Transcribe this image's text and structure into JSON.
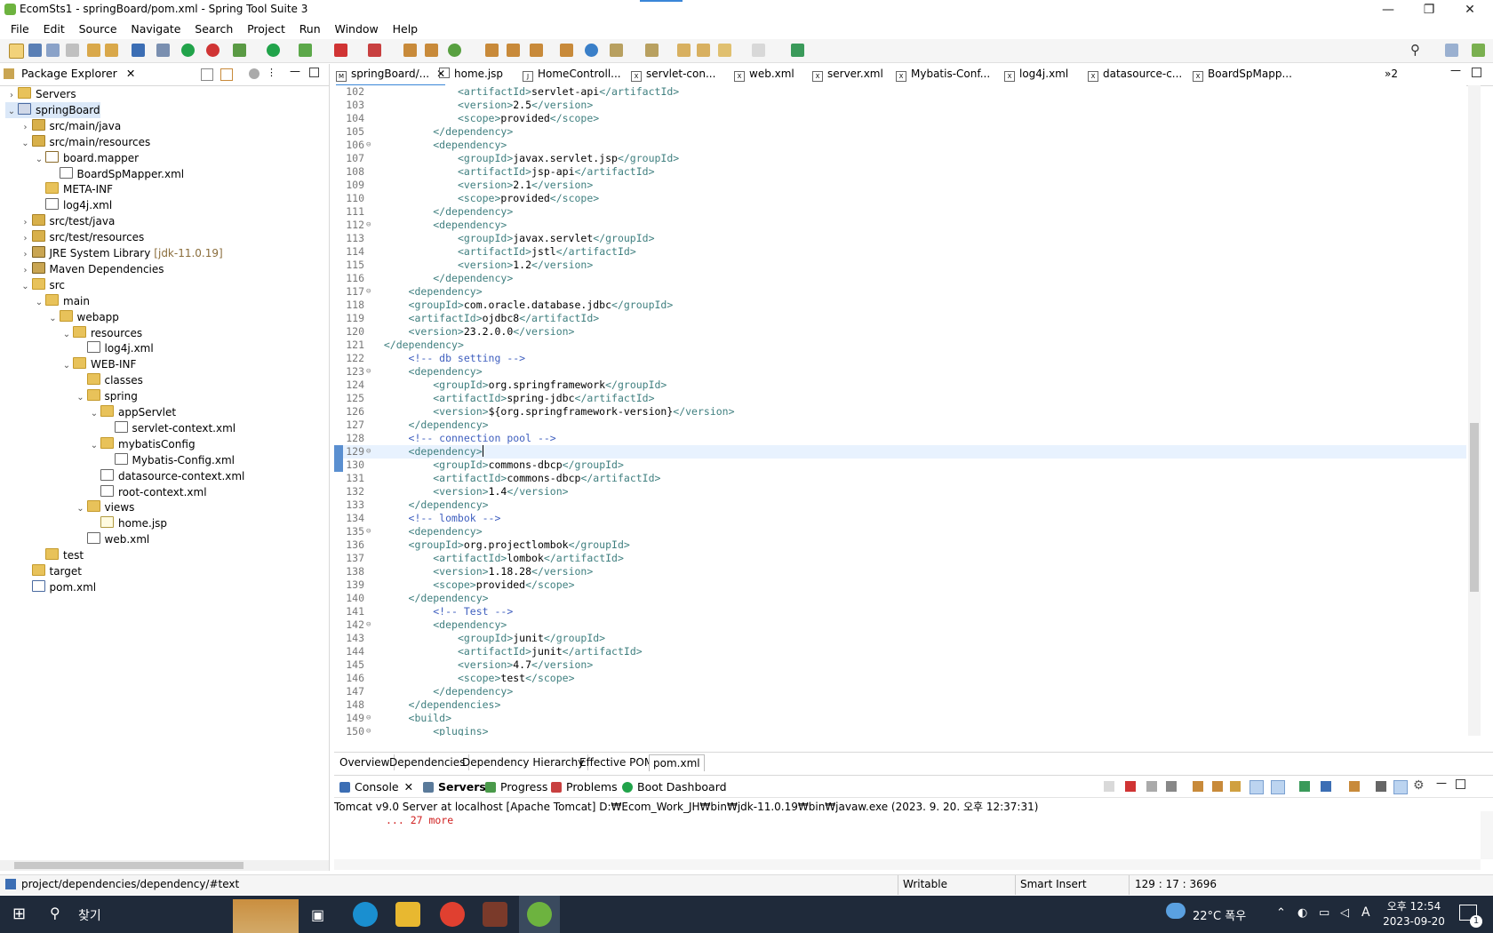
{
  "window": {
    "title": "EcomSts1 - springBoard/pom.xml - Spring Tool Suite 3"
  },
  "menu": [
    "File",
    "Edit",
    "Source",
    "Navigate",
    "Search",
    "Project",
    "Run",
    "Window",
    "Help"
  ],
  "package_explorer": {
    "title": "Package Explorer",
    "tree": [
      {
        "label": "Servers",
        "depth": 0,
        "arrow": "›",
        "icon": "servers"
      },
      {
        "label": "springBoard",
        "depth": 0,
        "arrow": "⌄",
        "icon": "proj",
        "selected": true
      },
      {
        "label": "src/main/java",
        "depth": 1,
        "arrow": "›",
        "icon": "pkgroot"
      },
      {
        "label": "src/main/resources",
        "depth": 1,
        "arrow": "⌄",
        "icon": "pkgroot"
      },
      {
        "label": "board.mapper",
        "depth": 2,
        "arrow": "⌄",
        "icon": "pkg"
      },
      {
        "label": "BoardSpMapper.xml",
        "depth": 3,
        "arrow": "",
        "icon": "xml"
      },
      {
        "label": "META-INF",
        "depth": 2,
        "arrow": "",
        "icon": "folder"
      },
      {
        "label": "log4j.xml",
        "depth": 2,
        "arrow": "",
        "icon": "xml"
      },
      {
        "label": "src/test/java",
        "depth": 1,
        "arrow": "›",
        "icon": "pkgroot"
      },
      {
        "label": "src/test/resources",
        "depth": 1,
        "arrow": "›",
        "icon": "pkgroot"
      },
      {
        "label": "JRE System Library",
        "extra": "[jdk-11.0.19]",
        "depth": 1,
        "arrow": "›",
        "icon": "lib"
      },
      {
        "label": "Maven Dependencies",
        "depth": 1,
        "arrow": "›",
        "icon": "lib"
      },
      {
        "label": "src",
        "depth": 1,
        "arrow": "⌄",
        "icon": "folder"
      },
      {
        "label": "main",
        "depth": 2,
        "arrow": "⌄",
        "icon": "folder"
      },
      {
        "label": "webapp",
        "depth": 3,
        "arrow": "⌄",
        "icon": "folder"
      },
      {
        "label": "resources",
        "depth": 4,
        "arrow": "⌄",
        "icon": "folder"
      },
      {
        "label": "log4j.xml",
        "depth": 5,
        "arrow": "",
        "icon": "xml"
      },
      {
        "label": "WEB-INF",
        "depth": 4,
        "arrow": "⌄",
        "icon": "folder"
      },
      {
        "label": "classes",
        "depth": 5,
        "arrow": "",
        "icon": "folder"
      },
      {
        "label": "spring",
        "depth": 5,
        "arrow": "⌄",
        "icon": "folder"
      },
      {
        "label": "appServlet",
        "depth": 6,
        "arrow": "⌄",
        "icon": "folder"
      },
      {
        "label": "servlet-context.xml",
        "depth": 7,
        "arrow": "",
        "icon": "xml"
      },
      {
        "label": "mybatisConfig",
        "depth": 6,
        "arrow": "⌄",
        "icon": "folder"
      },
      {
        "label": "Mybatis-Config.xml",
        "depth": 7,
        "arrow": "",
        "icon": "xml"
      },
      {
        "label": "datasource-context.xml",
        "depth": 6,
        "arrow": "",
        "icon": "xml"
      },
      {
        "label": "root-context.xml",
        "depth": 6,
        "arrow": "",
        "icon": "xml"
      },
      {
        "label": "views",
        "depth": 5,
        "arrow": "⌄",
        "icon": "folder"
      },
      {
        "label": "home.jsp",
        "depth": 6,
        "arrow": "",
        "icon": "jsp"
      },
      {
        "label": "web.xml",
        "depth": 5,
        "arrow": "",
        "icon": "xml"
      },
      {
        "label": "test",
        "depth": 2,
        "arrow": "",
        "icon": "folder"
      },
      {
        "label": "target",
        "depth": 1,
        "arrow": "",
        "icon": "folder"
      },
      {
        "label": "pom.xml",
        "depth": 1,
        "arrow": "",
        "icon": "pom"
      }
    ]
  },
  "editor_tabs": [
    "springBoard/...",
    "home.jsp",
    "HomeControll...",
    "servlet-con...",
    "web.xml",
    "server.xml",
    "Mybatis-Conf...",
    "log4j.xml",
    "datasource-c...",
    "BoardSpMapp..."
  ],
  "editor_tabs_overflow": "»2",
  "code": [
    {
      "n": "102",
      "indent": 3,
      "parts": [
        [
          "tag",
          "<artifactId>"
        ],
        [
          "txt",
          "servlet-api"
        ],
        [
          "tag",
          "</artifactId>"
        ]
      ]
    },
    {
      "n": "103",
      "indent": 3,
      "parts": [
        [
          "tag",
          "<version>"
        ],
        [
          "txt",
          "2.5"
        ],
        [
          "tag",
          "</version>"
        ]
      ]
    },
    {
      "n": "104",
      "indent": 3,
      "parts": [
        [
          "tag",
          "<scope>"
        ],
        [
          "txt",
          "provided"
        ],
        [
          "tag",
          "</scope>"
        ]
      ]
    },
    {
      "n": "105",
      "indent": 2,
      "parts": [
        [
          "tag",
          "</dependency>"
        ]
      ]
    },
    {
      "n": "106",
      "indent": 2,
      "fold": true,
      "parts": [
        [
          "tag",
          "<dependency>"
        ]
      ]
    },
    {
      "n": "107",
      "indent": 3,
      "parts": [
        [
          "tag",
          "<groupId>"
        ],
        [
          "txt",
          "javax.servlet.jsp"
        ],
        [
          "tag",
          "</groupId>"
        ]
      ]
    },
    {
      "n": "108",
      "indent": 3,
      "parts": [
        [
          "tag",
          "<artifactId>"
        ],
        [
          "txt",
          "jsp-api"
        ],
        [
          "tag",
          "</artifactId>"
        ]
      ]
    },
    {
      "n": "109",
      "indent": 3,
      "parts": [
        [
          "tag",
          "<version>"
        ],
        [
          "txt",
          "2.1"
        ],
        [
          "tag",
          "</version>"
        ]
      ]
    },
    {
      "n": "110",
      "indent": 3,
      "parts": [
        [
          "tag",
          "<scope>"
        ],
        [
          "txt",
          "provided"
        ],
        [
          "tag",
          "</scope>"
        ]
      ]
    },
    {
      "n": "111",
      "indent": 2,
      "parts": [
        [
          "tag",
          "</dependency>"
        ]
      ]
    },
    {
      "n": "112",
      "indent": 2,
      "fold": true,
      "parts": [
        [
          "tag",
          "<dependency>"
        ]
      ]
    },
    {
      "n": "113",
      "indent": 3,
      "parts": [
        [
          "tag",
          "<groupId>"
        ],
        [
          "txt",
          "javax.servlet"
        ],
        [
          "tag",
          "</groupId>"
        ]
      ]
    },
    {
      "n": "114",
      "indent": 3,
      "parts": [
        [
          "tag",
          "<artifactId>"
        ],
        [
          "txt",
          "jstl"
        ],
        [
          "tag",
          "</artifactId>"
        ]
      ]
    },
    {
      "n": "115",
      "indent": 3,
      "parts": [
        [
          "tag",
          "<version>"
        ],
        [
          "txt",
          "1.2"
        ],
        [
          "tag",
          "</version>"
        ]
      ]
    },
    {
      "n": "116",
      "indent": 2,
      "parts": [
        [
          "tag",
          "</dependency>"
        ]
      ]
    },
    {
      "n": "117",
      "indent": 1,
      "fold": true,
      "parts": [
        [
          "tag",
          "<dependency>"
        ]
      ]
    },
    {
      "n": "118",
      "indent": 1,
      "parts": [
        [
          "tag",
          "<groupId>"
        ],
        [
          "txt",
          "com.oracle.database.jdbc"
        ],
        [
          "tag",
          "</groupId>"
        ]
      ]
    },
    {
      "n": "119",
      "indent": 1,
      "parts": [
        [
          "tag",
          "<artifactId>"
        ],
        [
          "txt",
          "ojdbc8"
        ],
        [
          "tag",
          "</artifactId>"
        ]
      ]
    },
    {
      "n": "120",
      "indent": 1,
      "parts": [
        [
          "tag",
          "<version>"
        ],
        [
          "txt",
          "23.2.0.0"
        ],
        [
          "tag",
          "</version>"
        ]
      ]
    },
    {
      "n": "121",
      "indent": 0,
      "parts": [
        [
          "tag",
          "</dependency>"
        ]
      ]
    },
    {
      "n": "122",
      "indent": 1,
      "parts": [
        [
          "cm",
          "<!-- db setting -->"
        ]
      ]
    },
    {
      "n": "123",
      "indent": 1,
      "fold": true,
      "parts": [
        [
          "tag",
          "<dependency>"
        ]
      ]
    },
    {
      "n": "124",
      "indent": 2,
      "parts": [
        [
          "tag",
          "<groupId>"
        ],
        [
          "txt",
          "org.springframework"
        ],
        [
          "tag",
          "</groupId>"
        ]
      ]
    },
    {
      "n": "125",
      "indent": 2,
      "parts": [
        [
          "tag",
          "<artifactId>"
        ],
        [
          "txt",
          "spring-jdbc"
        ],
        [
          "tag",
          "</artifactId>"
        ]
      ]
    },
    {
      "n": "126",
      "indent": 2,
      "parts": [
        [
          "tag",
          "<version>"
        ],
        [
          "txt",
          "${org.springframework-version}"
        ],
        [
          "tag",
          "</version>"
        ]
      ]
    },
    {
      "n": "127",
      "indent": 1,
      "parts": [
        [
          "tag",
          "</dependency>"
        ]
      ]
    },
    {
      "n": "128",
      "indent": 1,
      "parts": [
        [
          "cm",
          "<!-- connection pool -->"
        ]
      ]
    },
    {
      "n": "129",
      "indent": 1,
      "fold": true,
      "current": true,
      "parts": [
        [
          "tag",
          "<dependency>"
        ]
      ]
    },
    {
      "n": "130",
      "indent": 2,
      "parts": [
        [
          "tag",
          "<groupId>"
        ],
        [
          "txt",
          "commons-dbcp"
        ],
        [
          "tag",
          "</groupId>"
        ]
      ]
    },
    {
      "n": "131",
      "indent": 2,
      "parts": [
        [
          "tag",
          "<artifactId>"
        ],
        [
          "txt",
          "commons-dbcp"
        ],
        [
          "tag",
          "</artifactId>"
        ]
      ]
    },
    {
      "n": "132",
      "indent": 2,
      "parts": [
        [
          "tag",
          "<version>"
        ],
        [
          "txt",
          "1.4"
        ],
        [
          "tag",
          "</version>"
        ]
      ]
    },
    {
      "n": "133",
      "indent": 1,
      "parts": [
        [
          "tag",
          "</dependency>"
        ]
      ]
    },
    {
      "n": "134",
      "indent": 1,
      "parts": [
        [
          "cm",
          "<!-- lombok -->"
        ]
      ]
    },
    {
      "n": "135",
      "indent": 1,
      "fold": true,
      "parts": [
        [
          "tag",
          "<dependency>"
        ]
      ]
    },
    {
      "n": "136",
      "indent": 1,
      "parts": [
        [
          "tag",
          "<groupId>"
        ],
        [
          "txt",
          "org.projectlombok"
        ],
        [
          "tag",
          "</groupId>"
        ]
      ]
    },
    {
      "n": "137",
      "indent": 2,
      "parts": [
        [
          "tag",
          "<artifactId>"
        ],
        [
          "txt",
          "lombok"
        ],
        [
          "tag",
          "</artifactId>"
        ]
      ]
    },
    {
      "n": "138",
      "indent": 2,
      "parts": [
        [
          "tag",
          "<version>"
        ],
        [
          "txt",
          "1.18.28"
        ],
        [
          "tag",
          "</version>"
        ]
      ]
    },
    {
      "n": "139",
      "indent": 2,
      "parts": [
        [
          "tag",
          "<scope>"
        ],
        [
          "txt",
          "provided"
        ],
        [
          "tag",
          "</scope>"
        ]
      ]
    },
    {
      "n": "140",
      "indent": 1,
      "parts": [
        [
          "tag",
          "</dependency>"
        ]
      ]
    },
    {
      "n": "141",
      "indent": 2,
      "parts": [
        [
          "cm",
          "<!-- Test -->"
        ]
      ]
    },
    {
      "n": "142",
      "indent": 2,
      "fold": true,
      "parts": [
        [
          "tag",
          "<dependency>"
        ]
      ]
    },
    {
      "n": "143",
      "indent": 3,
      "parts": [
        [
          "tag",
          "<groupId>"
        ],
        [
          "txt",
          "junit"
        ],
        [
          "tag",
          "</groupId>"
        ]
      ]
    },
    {
      "n": "144",
      "indent": 3,
      "parts": [
        [
          "tag",
          "<artifactId>"
        ],
        [
          "txt",
          "junit"
        ],
        [
          "tag",
          "</artifactId>"
        ]
      ]
    },
    {
      "n": "145",
      "indent": 3,
      "parts": [
        [
          "tag",
          "<version>"
        ],
        [
          "txt",
          "4.7"
        ],
        [
          "tag",
          "</version>"
        ]
      ]
    },
    {
      "n": "146",
      "indent": 3,
      "parts": [
        [
          "tag",
          "<scope>"
        ],
        [
          "txt",
          "test"
        ],
        [
          "tag",
          "</scope>"
        ]
      ]
    },
    {
      "n": "147",
      "indent": 2,
      "parts": [
        [
          "tag",
          "</dependency>"
        ]
      ]
    },
    {
      "n": "148",
      "indent": 1,
      "parts": [
        [
          "tag",
          "</dependencies>"
        ]
      ]
    },
    {
      "n": "149",
      "indent": 1,
      "fold": true,
      "parts": [
        [
          "tag",
          "<build>"
        ]
      ]
    },
    {
      "n": "150",
      "indent": 2,
      "fold": true,
      "parts": [
        [
          "tag",
          "<plugins>"
        ]
      ]
    }
  ],
  "pom_tabs": [
    "Overview",
    "Dependencies",
    "Dependency Hierarchy",
    "Effective POM",
    "pom.xml"
  ],
  "bottom_tabs": [
    "Console",
    "Servers",
    "Progress",
    "Problems",
    "Boot Dashboard"
  ],
  "console": {
    "header": "Tomcat v9.0 Server at localhost [Apache Tomcat] D:₩Ecom_Work_JH₩bin₩jdk-11.0.19₩bin₩javaw.exe  (2023. 9. 20. 오후 12:37:31)",
    "line": "... 27 more"
  },
  "status": {
    "path": "project/dependencies/dependency/#text",
    "writable": "Writable",
    "insert": "Smart Insert",
    "position": "129 : 17 : 3696"
  },
  "taskbar": {
    "search": "찾기",
    "weather": "22°C  폭우",
    "time": "오후 12:54",
    "date": "2023-09-20",
    "notif": "1",
    "ime": "A"
  },
  "colors": {
    "accent": "#3a86d8",
    "tag": "#3f7f7f",
    "comment": "#3f5fbf",
    "taskbar": "#1f2a3a"
  }
}
